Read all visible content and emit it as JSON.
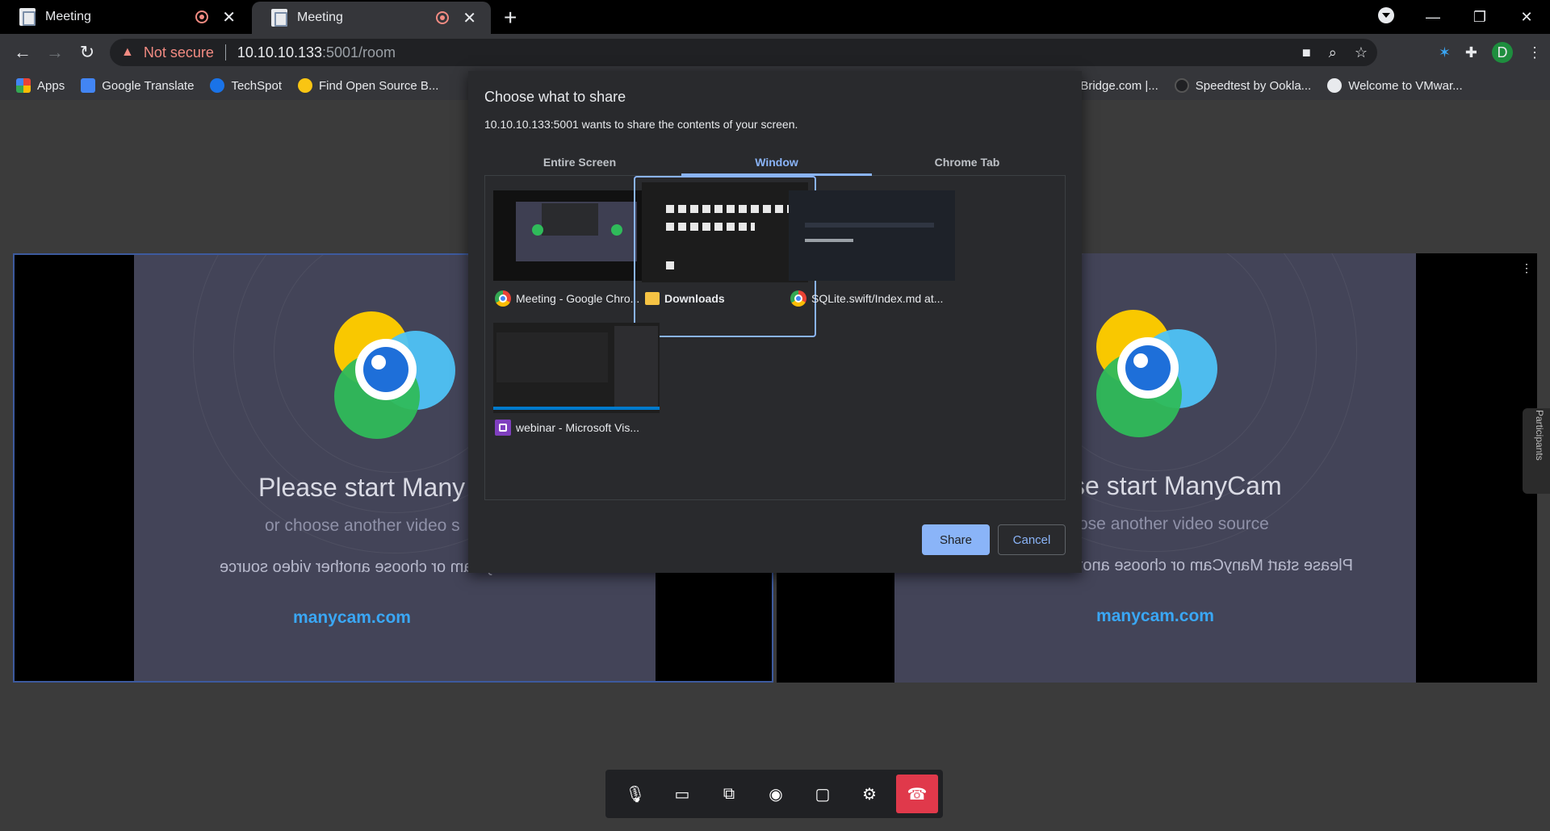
{
  "browser": {
    "tabs": [
      {
        "title": "Meeting",
        "active": false
      },
      {
        "title": "Meeting",
        "active": true
      }
    ],
    "new_tab": "+",
    "profile_initial": "D",
    "toolbar": {
      "security_label": "Not secure",
      "url_host": "10.10.10.133",
      "url_path": ":5001/room"
    },
    "bookmarks": [
      {
        "label": "Apps",
        "icon": "apps-grid-icon"
      },
      {
        "label": "Google Translate",
        "icon": "translate-icon"
      },
      {
        "label": "TechSpot",
        "icon": "techspot-icon"
      },
      {
        "label": "Find Open Source B...",
        "icon": "emoji-icon"
      },
      {
        "label": "AirBridge.com |...",
        "icon": "page-icon"
      },
      {
        "label": "Speedtest by Ookla...",
        "icon": "speedtest-icon"
      },
      {
        "label": "Welcome to VMwar...",
        "icon": "globe-icon"
      }
    ]
  },
  "page": {
    "video_left": {
      "headline": "Please start Many",
      "subline": "or choose another video s",
      "mirror_text": "Please start ManyCam or choose another video source",
      "site": "manycam.com"
    },
    "video_right": {
      "headline": "se start ManyCam",
      "subline": "ose another video source",
      "mirror_text": "Please start ManyCam or choose another video source",
      "site": "manycam.com"
    },
    "participants_label": "Participants",
    "controls": [
      "microphone-icon",
      "camera-icon",
      "screen-share-icon",
      "record-icon",
      "chat-icon",
      "settings-icon",
      "hang-up-icon"
    ]
  },
  "dialog": {
    "title": "Choose what to share",
    "subtitle": "10.10.10.133:5001 wants to share the contents of your screen.",
    "tabs": [
      "Entire Screen",
      "Window",
      "Chrome Tab"
    ],
    "active_tab": "Window",
    "windows": [
      {
        "label": "Meeting - Google Chro...",
        "icon": "chrome-icon",
        "selected": false
      },
      {
        "label": "Downloads",
        "icon": "folder-icon",
        "selected": true
      },
      {
        "label": "SQLite.swift/Index.md at...",
        "icon": "chrome-icon",
        "selected": false
      },
      {
        "label": "webinar - Microsoft Vis...",
        "icon": "visual-studio-icon",
        "selected": false
      }
    ],
    "share_label": "Share",
    "cancel_label": "Cancel"
  },
  "colors": {
    "accent": "#8ab4f8",
    "hangup": "#e0394b",
    "manycam_link": "#3aa7f5",
    "warning": "#f28b82"
  }
}
